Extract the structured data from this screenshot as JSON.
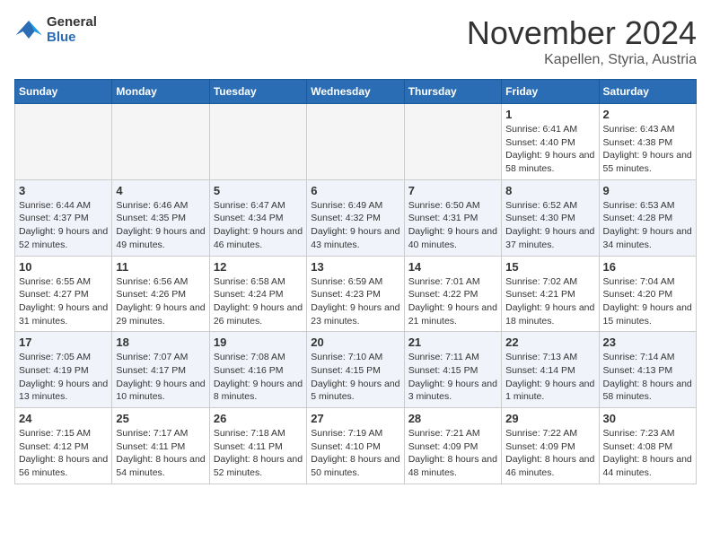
{
  "header": {
    "logo_line1": "General",
    "logo_line2": "Blue",
    "month": "November 2024",
    "location": "Kapellen, Styria, Austria"
  },
  "weekdays": [
    "Sunday",
    "Monday",
    "Tuesday",
    "Wednesday",
    "Thursday",
    "Friday",
    "Saturday"
  ],
  "weeks": [
    [
      {
        "day": "",
        "info": ""
      },
      {
        "day": "",
        "info": ""
      },
      {
        "day": "",
        "info": ""
      },
      {
        "day": "",
        "info": ""
      },
      {
        "day": "",
        "info": ""
      },
      {
        "day": "1",
        "info": "Sunrise: 6:41 AM\nSunset: 4:40 PM\nDaylight: 9 hours and 58 minutes."
      },
      {
        "day": "2",
        "info": "Sunrise: 6:43 AM\nSunset: 4:38 PM\nDaylight: 9 hours and 55 minutes."
      }
    ],
    [
      {
        "day": "3",
        "info": "Sunrise: 6:44 AM\nSunset: 4:37 PM\nDaylight: 9 hours and 52 minutes."
      },
      {
        "day": "4",
        "info": "Sunrise: 6:46 AM\nSunset: 4:35 PM\nDaylight: 9 hours and 49 minutes."
      },
      {
        "day": "5",
        "info": "Sunrise: 6:47 AM\nSunset: 4:34 PM\nDaylight: 9 hours and 46 minutes."
      },
      {
        "day": "6",
        "info": "Sunrise: 6:49 AM\nSunset: 4:32 PM\nDaylight: 9 hours and 43 minutes."
      },
      {
        "day": "7",
        "info": "Sunrise: 6:50 AM\nSunset: 4:31 PM\nDaylight: 9 hours and 40 minutes."
      },
      {
        "day": "8",
        "info": "Sunrise: 6:52 AM\nSunset: 4:30 PM\nDaylight: 9 hours and 37 minutes."
      },
      {
        "day": "9",
        "info": "Sunrise: 6:53 AM\nSunset: 4:28 PM\nDaylight: 9 hours and 34 minutes."
      }
    ],
    [
      {
        "day": "10",
        "info": "Sunrise: 6:55 AM\nSunset: 4:27 PM\nDaylight: 9 hours and 31 minutes."
      },
      {
        "day": "11",
        "info": "Sunrise: 6:56 AM\nSunset: 4:26 PM\nDaylight: 9 hours and 29 minutes."
      },
      {
        "day": "12",
        "info": "Sunrise: 6:58 AM\nSunset: 4:24 PM\nDaylight: 9 hours and 26 minutes."
      },
      {
        "day": "13",
        "info": "Sunrise: 6:59 AM\nSunset: 4:23 PM\nDaylight: 9 hours and 23 minutes."
      },
      {
        "day": "14",
        "info": "Sunrise: 7:01 AM\nSunset: 4:22 PM\nDaylight: 9 hours and 21 minutes."
      },
      {
        "day": "15",
        "info": "Sunrise: 7:02 AM\nSunset: 4:21 PM\nDaylight: 9 hours and 18 minutes."
      },
      {
        "day": "16",
        "info": "Sunrise: 7:04 AM\nSunset: 4:20 PM\nDaylight: 9 hours and 15 minutes."
      }
    ],
    [
      {
        "day": "17",
        "info": "Sunrise: 7:05 AM\nSunset: 4:19 PM\nDaylight: 9 hours and 13 minutes."
      },
      {
        "day": "18",
        "info": "Sunrise: 7:07 AM\nSunset: 4:17 PM\nDaylight: 9 hours and 10 minutes."
      },
      {
        "day": "19",
        "info": "Sunrise: 7:08 AM\nSunset: 4:16 PM\nDaylight: 9 hours and 8 minutes."
      },
      {
        "day": "20",
        "info": "Sunrise: 7:10 AM\nSunset: 4:15 PM\nDaylight: 9 hours and 5 minutes."
      },
      {
        "day": "21",
        "info": "Sunrise: 7:11 AM\nSunset: 4:15 PM\nDaylight: 9 hours and 3 minutes."
      },
      {
        "day": "22",
        "info": "Sunrise: 7:13 AM\nSunset: 4:14 PM\nDaylight: 9 hours and 1 minute."
      },
      {
        "day": "23",
        "info": "Sunrise: 7:14 AM\nSunset: 4:13 PM\nDaylight: 8 hours and 58 minutes."
      }
    ],
    [
      {
        "day": "24",
        "info": "Sunrise: 7:15 AM\nSunset: 4:12 PM\nDaylight: 8 hours and 56 minutes."
      },
      {
        "day": "25",
        "info": "Sunrise: 7:17 AM\nSunset: 4:11 PM\nDaylight: 8 hours and 54 minutes."
      },
      {
        "day": "26",
        "info": "Sunrise: 7:18 AM\nSunset: 4:11 PM\nDaylight: 8 hours and 52 minutes."
      },
      {
        "day": "27",
        "info": "Sunrise: 7:19 AM\nSunset: 4:10 PM\nDaylight: 8 hours and 50 minutes."
      },
      {
        "day": "28",
        "info": "Sunrise: 7:21 AM\nSunset: 4:09 PM\nDaylight: 8 hours and 48 minutes."
      },
      {
        "day": "29",
        "info": "Sunrise: 7:22 AM\nSunset: 4:09 PM\nDaylight: 8 hours and 46 minutes."
      },
      {
        "day": "30",
        "info": "Sunrise: 7:23 AM\nSunset: 4:08 PM\nDaylight: 8 hours and 44 minutes."
      }
    ]
  ]
}
